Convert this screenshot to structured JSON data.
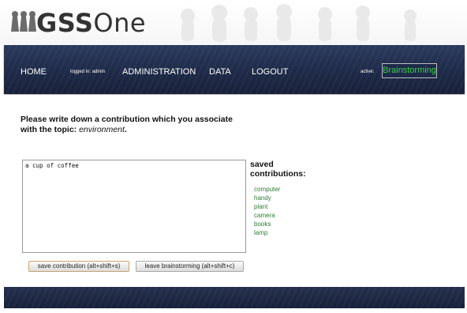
{
  "app": {
    "logo_text_bold": "GSS",
    "logo_text_light": "One"
  },
  "nav": {
    "home": "HOME",
    "logged_in": "logged in: admin",
    "administration": "ADMINISTRATION",
    "data": "DATA",
    "logout": "LOGOUT",
    "active_label": "active:",
    "active_value": "Brainstorming"
  },
  "main": {
    "prompt_line1": "Please write down a contribution which you associate",
    "prompt_line2_prefix": "with the topic: ",
    "topic": "environment",
    "prompt_line2_suffix": ".",
    "contribution_value": "a cup of coffee ",
    "saved_title_line1": "saved",
    "saved_title_line2": "contributions:",
    "saved_contributions": [
      "computer",
      "handy",
      "plant",
      "camera",
      "books",
      "lamp"
    ],
    "save_button": "save contribution (alt+shift+s)",
    "leave_button": "leave brainstorming (alt+shift+c)"
  },
  "colors": {
    "nav_bg": "#1e2a48",
    "active_text": "#3ccd49",
    "saved_item": "#2e7d32"
  },
  "icons": [
    "logo-keyhole-icon"
  ]
}
